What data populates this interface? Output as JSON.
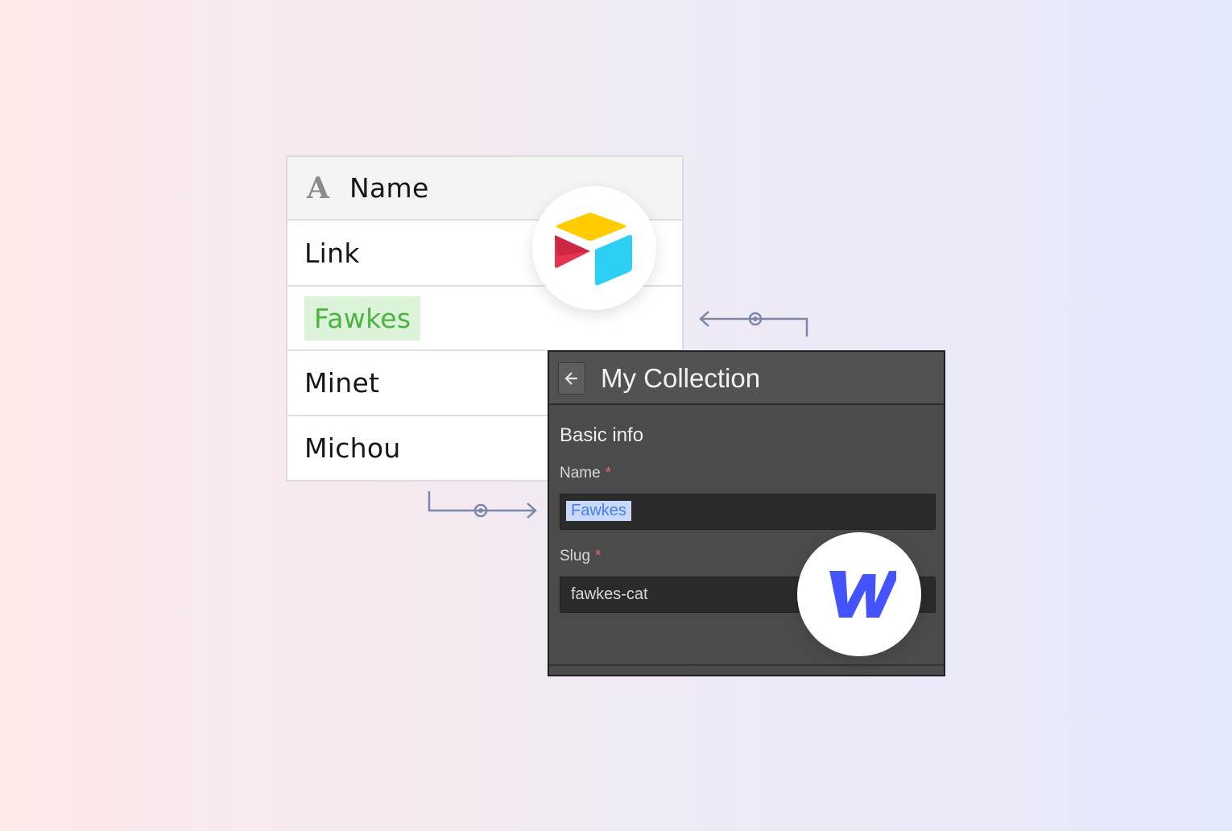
{
  "table": {
    "header_icon": "A",
    "header_label": "Name",
    "rows": [
      "Link",
      "Fawkes",
      "Minet",
      "Michou"
    ],
    "highlighted_row": "Fawkes",
    "logo": "airtable-logo"
  },
  "panel": {
    "title": "My Collection",
    "section": "Basic info",
    "name_label": "Name",
    "name_required": "*",
    "name_value": "Fawkes",
    "slug_label": "Slug",
    "slug_required": "*",
    "slug_value": "fawkes-cat",
    "logo": "webflow-logo"
  },
  "colors": {
    "highlight_bg": "#dcf2d9",
    "highlight_text": "#4bb43f",
    "panel_bg": "#4b4b4b",
    "connector": "#7b87aa",
    "webflow_blue": "#4353ff"
  }
}
